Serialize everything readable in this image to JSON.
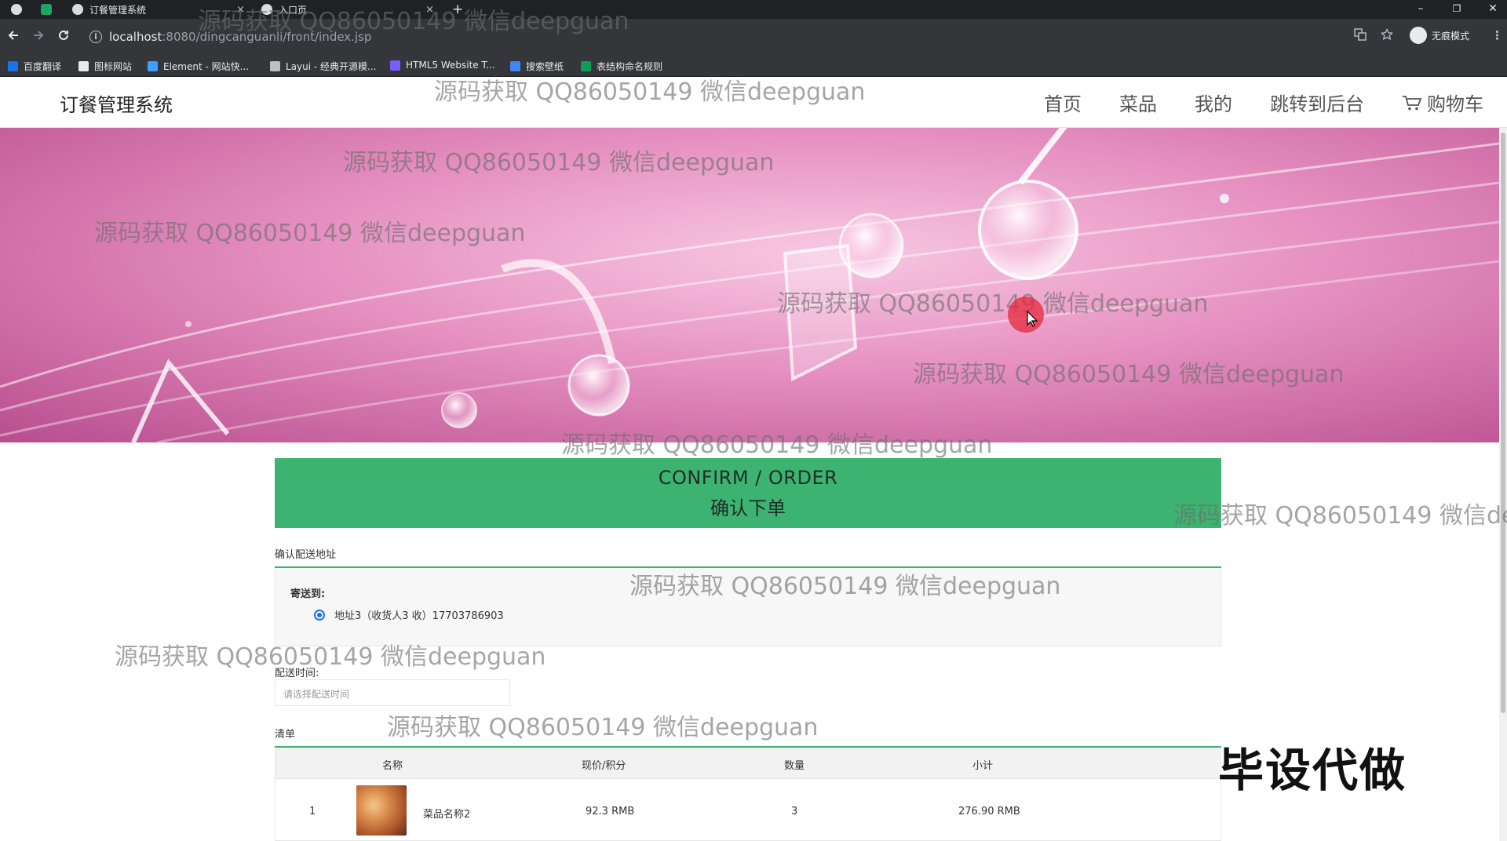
{
  "browser": {
    "tabs": [
      {
        "title": ""
      },
      {
        "title": "订餐管理系统",
        "close": "×"
      },
      {
        "title": "入口页",
        "close": "×"
      }
    ],
    "new_tab": "+",
    "window_controls": {
      "minimize": "–",
      "restore": "❐",
      "close": "✕"
    },
    "url_host": "localhost",
    "url_path": ":8080/dingcanguanli/front/index.jsp",
    "profile_label": "无痕模式",
    "bookmarks": [
      {
        "label": "百度翻译",
        "color": "#1a73e8"
      },
      {
        "label": "图标网站",
        "color": "#e8eaed"
      },
      {
        "label": "Element - 网站快...",
        "color": "#409eff"
      },
      {
        "label": "Layui - 经典开源模...",
        "color": "#bdc1c6"
      },
      {
        "label": "HTML5 Website T...",
        "color": "#7b5cff"
      },
      {
        "label": "搜索壁纸",
        "color": "#4285f4"
      },
      {
        "label": "表结构命名规则",
        "color": "#0f9d58"
      }
    ]
  },
  "site": {
    "title": "订餐管理系统",
    "nav": [
      "首页",
      "菜品",
      "我的",
      "跳转到后台",
      "购物车"
    ]
  },
  "confirm": {
    "en": "CONFIRM / ORDER",
    "cn": "确认下单"
  },
  "address": {
    "section_label": "确认配送地址",
    "send_to": "寄送到:",
    "option": "地址3（收货人3 收）17703786903"
  },
  "delivery_time": {
    "label": "配送时间:",
    "placeholder": "请选择配送时间"
  },
  "order_list": {
    "label": "清单",
    "headers": [
      "名称",
      "现价/积分",
      "数量",
      "小计"
    ],
    "rows": [
      {
        "index": "1",
        "name": "菜品名称2",
        "price": "92.3 RMB",
        "qty": "3",
        "subtotal": "276.90 RMB"
      }
    ]
  },
  "overlays": {
    "watermark": "源码获取 QQ86050149 微信deepguan",
    "stamp": "毕设代做"
  },
  "colors": {
    "accent": "#3cb371",
    "banner": "#e58fc0",
    "chrome": "#35363a"
  }
}
